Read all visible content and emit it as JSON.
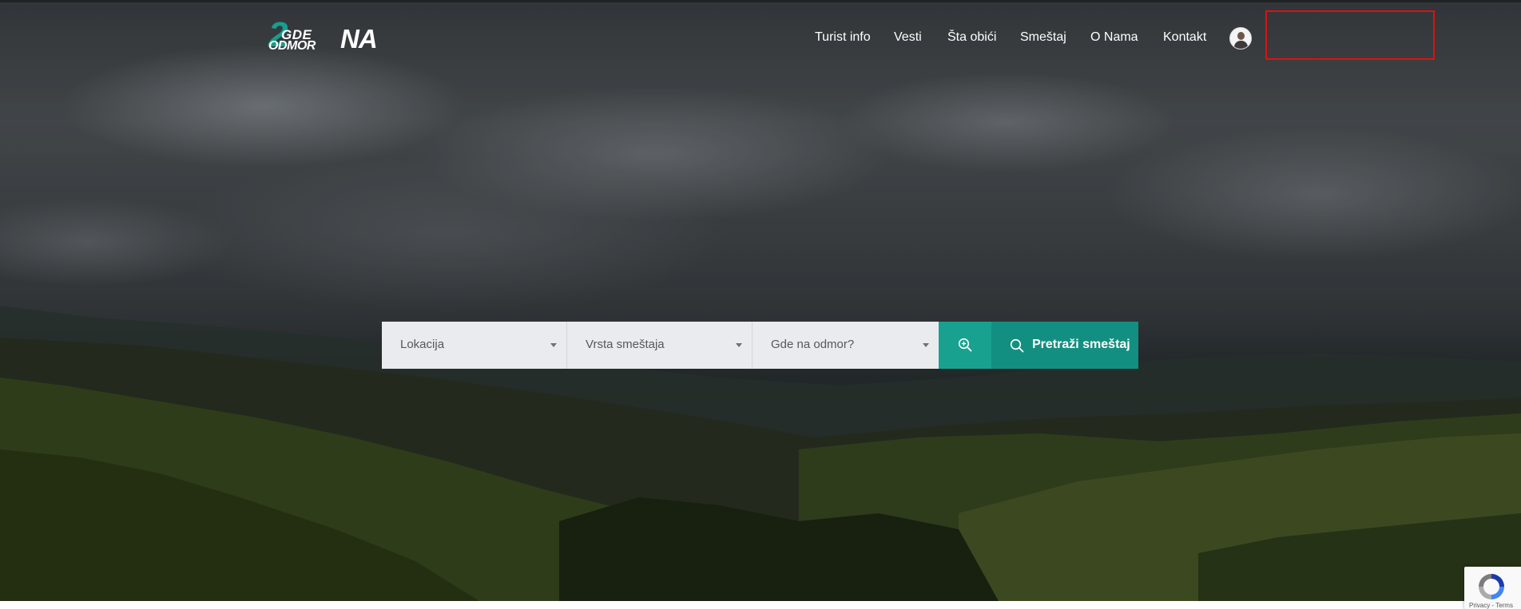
{
  "header": {
    "logo": {
      "digit": "2",
      "gde": "GDE",
      "odmor": "ODMOR",
      "na": "NA"
    },
    "nav": [
      {
        "label": "Turist info"
      },
      {
        "label": "Vesti"
      },
      {
        "label": "Šta obići"
      },
      {
        "label": "Smeštaj"
      },
      {
        "label": "O Nama"
      },
      {
        "label": "Kontakt"
      }
    ],
    "avatar_icon": "user-avatar"
  },
  "search": {
    "location": "Lokacija",
    "accommodation_type": "Vrsta smeštaja",
    "destination": "Gde na odmor?",
    "advanced_icon": "zoom-in-icon",
    "submit_label": "Pretraži smeštaj",
    "submit_icon": "search-icon"
  },
  "recaptcha": {
    "text": "Privacy - Terms"
  },
  "colors": {
    "accent": "#19a190",
    "accent_dark": "#138f81",
    "highlight": "#e01010"
  }
}
